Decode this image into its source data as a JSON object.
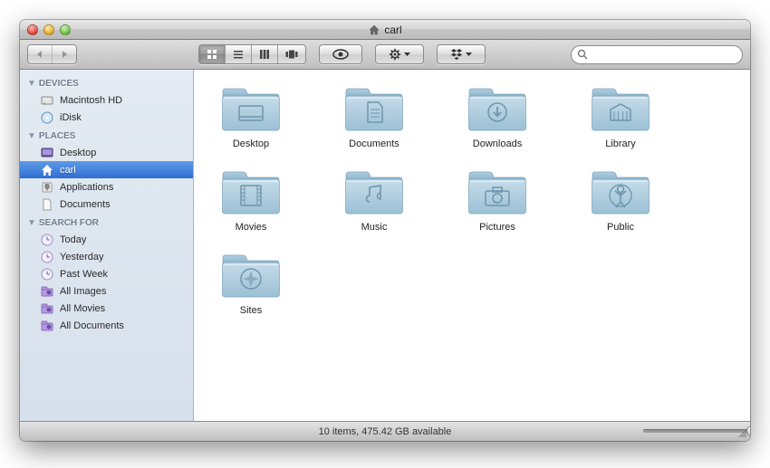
{
  "window": {
    "title": "carl",
    "status": "10 items, 475.42 GB available"
  },
  "search": {
    "placeholder": ""
  },
  "sidebar": {
    "sections": [
      {
        "header": "DEVICES",
        "items": [
          {
            "label": "Macintosh HD",
            "icon": "hdd"
          },
          {
            "label": "iDisk",
            "icon": "idisk"
          }
        ]
      },
      {
        "header": "PLACES",
        "items": [
          {
            "label": "Desktop",
            "icon": "desktop"
          },
          {
            "label": "carl",
            "icon": "home",
            "selected": true
          },
          {
            "label": "Applications",
            "icon": "app"
          },
          {
            "label": "Documents",
            "icon": "doc"
          }
        ]
      },
      {
        "header": "SEARCH FOR",
        "items": [
          {
            "label": "Today",
            "icon": "clock"
          },
          {
            "label": "Yesterday",
            "icon": "clock"
          },
          {
            "label": "Past Week",
            "icon": "clock"
          },
          {
            "label": "All Images",
            "icon": "smart"
          },
          {
            "label": "All Movies",
            "icon": "smart"
          },
          {
            "label": "All Documents",
            "icon": "smart"
          }
        ]
      }
    ]
  },
  "folders": [
    {
      "label": "Desktop",
      "glyph": "desktop"
    },
    {
      "label": "Documents",
      "glyph": "doc"
    },
    {
      "label": "Downloads",
      "glyph": "download"
    },
    {
      "label": "Library",
      "glyph": "library"
    },
    {
      "label": "Movies",
      "glyph": "movie"
    },
    {
      "label": "Music",
      "glyph": "music"
    },
    {
      "label": "Pictures",
      "glyph": "camera"
    },
    {
      "label": "Public",
      "glyph": "public"
    },
    {
      "label": "Sites",
      "glyph": "compass"
    }
  ]
}
